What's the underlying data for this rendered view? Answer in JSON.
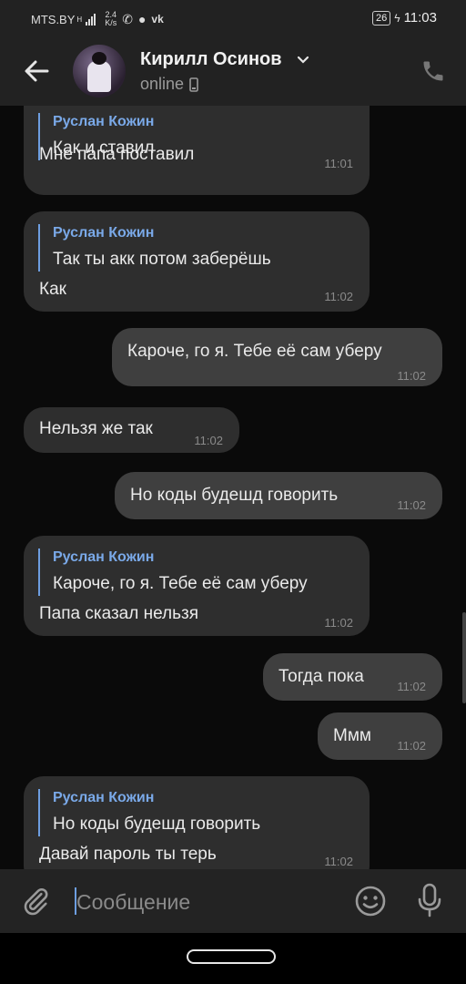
{
  "status_bar": {
    "carrier": "MTS.BY",
    "net_type": "H",
    "speed_value": "2.4",
    "speed_unit": "K/s",
    "battery": "26",
    "time": "11:03"
  },
  "header": {
    "contact_name": "Кирилл Осинов",
    "status": "online"
  },
  "messages": [
    {
      "type": "in",
      "reply_author": "Руслан Кожин",
      "reply_text": "Как и ставил",
      "text": "Мне папа поставил",
      "time": "11:01"
    },
    {
      "type": "in",
      "reply_author": "Руслан Кожин",
      "reply_text": "Так ты акк потом заберёшь",
      "text": "Как",
      "time": "11:02"
    },
    {
      "type": "out",
      "text": "Кароче, го я. Тебе её сам уберу",
      "time": "11:02"
    },
    {
      "type": "in",
      "text": "Нельзя же так",
      "time": "11:02"
    },
    {
      "type": "out",
      "text": "Но коды будешд говорить",
      "time": "11:02"
    },
    {
      "type": "in",
      "reply_author": "Руслан Кожин",
      "reply_text": "Кароче, го я. Тебе её сам уберу",
      "text": "Папа сказал нельзя",
      "time": "11:02"
    },
    {
      "type": "out",
      "text": "Тогда пока",
      "time": "11:02"
    },
    {
      "type": "out",
      "text": "Ммм",
      "time": "11:02"
    },
    {
      "type": "in",
      "reply_author": "Руслан Кожин",
      "reply_text": "Но коды будешд говорить",
      "text": "Давай пароль ты терь",
      "time": "11:02"
    }
  ],
  "composer": {
    "placeholder": "Сообщение"
  },
  "icons": {
    "back": "arrow-left-icon",
    "expand": "chevron-down-icon",
    "device": "mobile-device-icon",
    "call": "phone-icon",
    "attach": "paperclip-icon",
    "emoji": "smiley-icon",
    "voice": "microphone-icon"
  },
  "colors": {
    "accent": "#6d9ee0",
    "incoming_bubble": "#2e2e2e",
    "outgoing_bubble": "#3f3f3f",
    "background": "#0a0a0a"
  }
}
